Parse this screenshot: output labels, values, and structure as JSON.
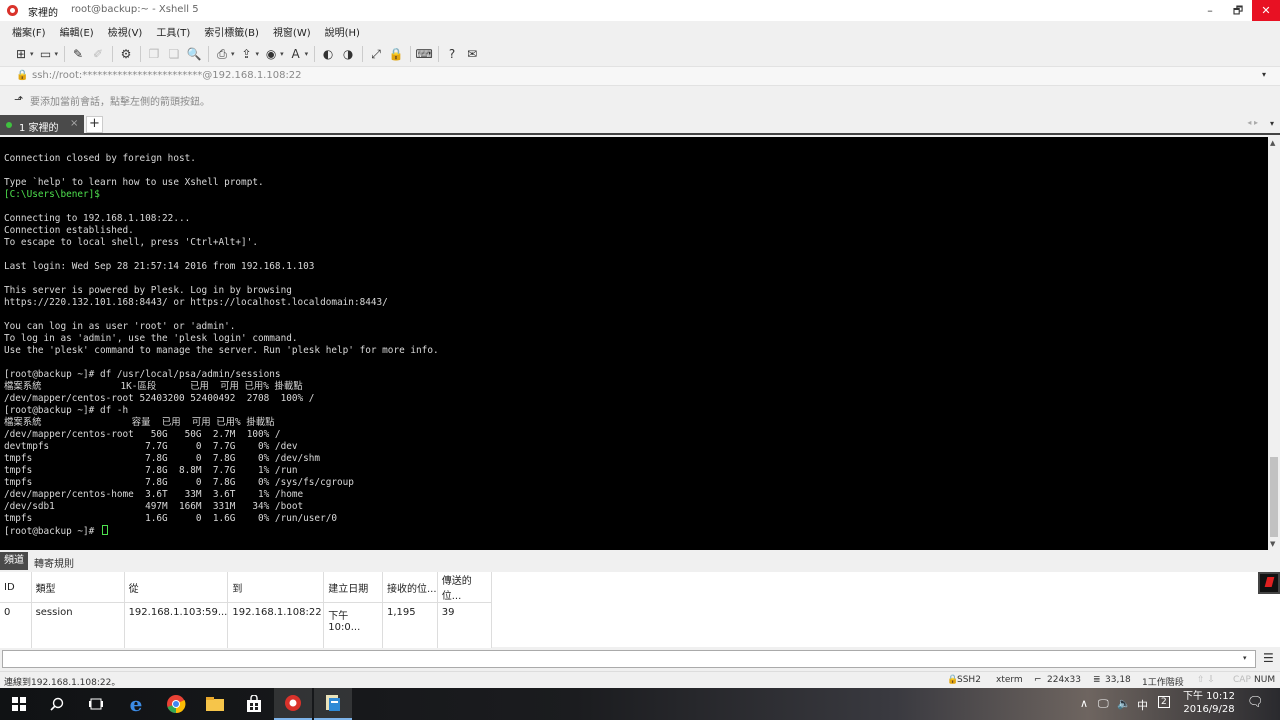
{
  "window": {
    "tab_title": "家裡的",
    "subtitle": "root@backup:~ - Xshell 5",
    "min": "–",
    "max": "🗗",
    "close": "✕"
  },
  "menu": [
    "檔案(F)",
    "編輯(E)",
    "檢視(V)",
    "工具(T)",
    "索引標籤(B)",
    "視窗(W)",
    "說明(H)"
  ],
  "toolbar_icons": [
    "new-session-icon",
    "open-folder-icon",
    "reconnect-icon",
    "disconnect-icon",
    "properties-icon",
    "copy-icon",
    "paste-icon",
    "find-icon",
    "print-icon",
    "transfer-icon",
    "globe-icon",
    "font-icon",
    "xftp-icon",
    "xmanager-icon",
    "fullscreen-icon",
    "lock-icon",
    "keyboard-icon",
    "help-icon",
    "chat-icon"
  ],
  "address": {
    "lock_glyph": "🔒",
    "text": "ssh://root:************************@192.168.1.108:22"
  },
  "hint": "要添加當前會話，點擊左側的箭頭按鈕。",
  "tabs": {
    "active_label": "1 家裡的",
    "close": "×",
    "add": "+"
  },
  "terminal": {
    "lines_before_prompt": [
      "Connection closed by foreign host.",
      "",
      "Type `help' to learn how to use Xshell prompt."
    ],
    "local_prompt": "[C:\\Users\\bener]$",
    "lines_after_prompt": [
      "",
      "Connecting to 192.168.1.108:22...",
      "Connection established.",
      "To escape to local shell, press 'Ctrl+Alt+]'.",
      "",
      "Last login: Wed Sep 28 21:57:14 2016 from 192.168.1.103",
      "",
      "This server is powered by Plesk. Log in by browsing",
      "https://220.132.101.168:8443/ or https://localhost.localdomain:8443/",
      "",
      "You can log in as user 'root' or 'admin'.",
      "To log in as 'admin', use the 'plesk login' command.",
      "Use the 'plesk' command to manage the server. Run 'plesk help' for more info.",
      "",
      "[root@backup ~]# df /usr/local/psa/admin/sessions",
      "檔案系統              1K-區段      已用  可用 已用% 掛載點",
      "/dev/mapper/centos-root 52403200 52400492  2708  100% /",
      "[root@backup ~]# df -h",
      "檔案系統                容量  已用  可用 已用% 掛載點",
      "/dev/mapper/centos-root   50G   50G  2.7M  100% /",
      "devtmpfs                 7.7G     0  7.7G    0% /dev",
      "tmpfs                    7.8G     0  7.8G    0% /dev/shm",
      "tmpfs                    7.8G  8.8M  7.7G    1% /run",
      "tmpfs                    7.8G     0  7.8G    0% /sys/fs/cgroup",
      "/dev/mapper/centos-home  3.6T   33M  3.6T    1% /home",
      "/dev/sdb1                497M  166M  331M   34% /boot",
      "tmpfs                    1.6G     0  1.6G    0% /run/user/0"
    ],
    "final_prompt": "[root@backup ~]# "
  },
  "panel": {
    "tabs": [
      "頻道",
      "轉寄規則"
    ],
    "columns": [
      "ID",
      "類型",
      "從",
      "到",
      "建立日期",
      "接收的位...",
      "傳送的位..."
    ],
    "rows": [
      [
        "0",
        "session",
        "192.168.1.103:59...",
        "192.168.1.108:22",
        "下午 10:0...",
        "1,195",
        "39"
      ]
    ]
  },
  "compose": {
    "dropdown": "▾",
    "menu": "☰"
  },
  "status": {
    "connected": "連線到192.168.1.108:22。",
    "protocol": "SSH2",
    "terminal": "xterm",
    "size": "224x33",
    "cursor": "33,18",
    "sessions": "1工作階段",
    "caps": "CAP",
    "num": "NUM"
  },
  "taskbar": {
    "ime": "中",
    "time": "下午 10:12",
    "date": "2016/9/28"
  }
}
